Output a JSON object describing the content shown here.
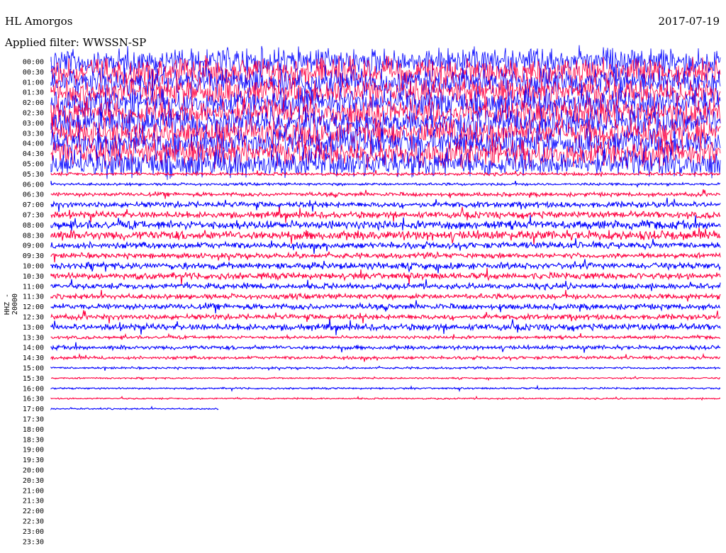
{
  "header": {
    "station": "HL Amorgos",
    "date": "2017-07-19",
    "filter": "Applied filter: WWSSN-SP",
    "channel": "HHZ - 20000"
  },
  "chart_data": {
    "type": "line",
    "title": "HL Amorgos",
    "subtitle": "Applied filter: WWSSN-SP",
    "ylabel": "HHZ - 20000",
    "row_labels": [
      "00:00",
      "00:30",
      "01:00",
      "01:30",
      "02:00",
      "02:30",
      "03:00",
      "03:30",
      "04:00",
      "04:30",
      "05:00",
      "05:30",
      "06:00",
      "06:30",
      "07:00",
      "07:30",
      "08:00",
      "08:30",
      "09:00",
      "09:30",
      "10:00",
      "10:30",
      "11:00",
      "11:30",
      "12:00",
      "12:30",
      "13:00",
      "13:30",
      "14:00",
      "14:30",
      "15:00",
      "15:30",
      "16:00",
      "16:30",
      "17:00",
      "17:30",
      "18:00",
      "18:30",
      "19:00",
      "19:30",
      "20:00",
      "20:30",
      "21:00",
      "21:30",
      "22:00",
      "22:30",
      "23:00",
      "23:30"
    ],
    "series_colors": [
      "#0000ff",
      "#ff0040"
    ],
    "record_end_row": 34,
    "record_end_fraction": 0.25,
    "amplitude_by_row": [
      1.0,
      1.0,
      1.0,
      1.0,
      1.0,
      1.0,
      1.0,
      1.0,
      1.0,
      1.0,
      1.0,
      0.12,
      0.1,
      0.15,
      0.22,
      0.25,
      0.32,
      0.36,
      0.25,
      0.2,
      0.25,
      0.25,
      0.22,
      0.2,
      0.22,
      0.2,
      0.25,
      0.12,
      0.16,
      0.12,
      0.08,
      0.06,
      0.07,
      0.06,
      0.06,
      0,
      0,
      0,
      0,
      0,
      0,
      0,
      0,
      0,
      0,
      0,
      0,
      0
    ],
    "grid": false
  }
}
